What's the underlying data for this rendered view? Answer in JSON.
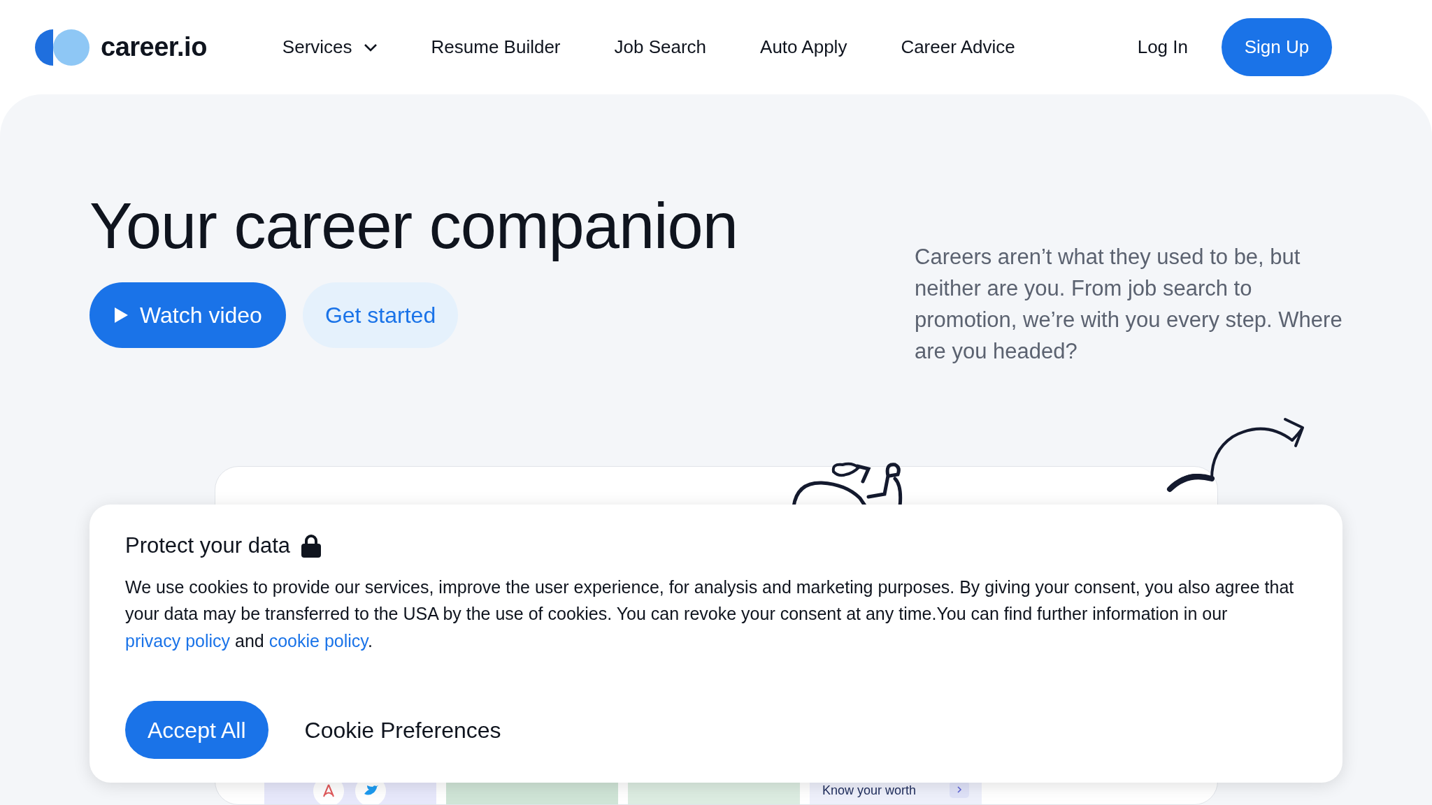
{
  "brand": {
    "name": "career.io"
  },
  "nav": {
    "items": [
      {
        "label": "Services",
        "kind": "dropdown"
      },
      {
        "label": "Resume Builder",
        "kind": "link"
      },
      {
        "label": "Job Search",
        "kind": "link"
      },
      {
        "label": "Auto Apply",
        "kind": "link"
      },
      {
        "label": "Career Advice",
        "kind": "link"
      }
    ]
  },
  "auth": {
    "login": "Log In",
    "signup": "Sign Up"
  },
  "hero": {
    "title": "Your career companion",
    "primary_button": "Watch video",
    "secondary_button": "Get started",
    "description": "Careers aren’t what they used to be, but neither are you. From job search to promotion, we’re with you every step. Where are you headed?"
  },
  "preview": {
    "tiles": [
      {
        "kind": "logos"
      },
      {
        "kind": "photo"
      },
      {
        "kind": "plain"
      },
      {
        "kind": "text",
        "label": "Know your worth"
      }
    ]
  },
  "cookie_banner": {
    "title": "Protect your data",
    "body": [
      {
        "kind": "text",
        "text": "We use cookies to provide our services, improve the user experience, for analysis and marketing purposes. By giving your consent, you also agree that your data may be transferred to the USA by the use of cookies. You can revoke your consent at any time.You can find further information in our "
      },
      {
        "kind": "link",
        "text": "privacy policy"
      },
      {
        "kind": "text",
        "text": " and "
      },
      {
        "kind": "link",
        "text": "cookie policy"
      },
      {
        "kind": "text",
        "text": "."
      }
    ],
    "accept_button": "Accept All",
    "preferences_button": "Cookie Preferences"
  }
}
